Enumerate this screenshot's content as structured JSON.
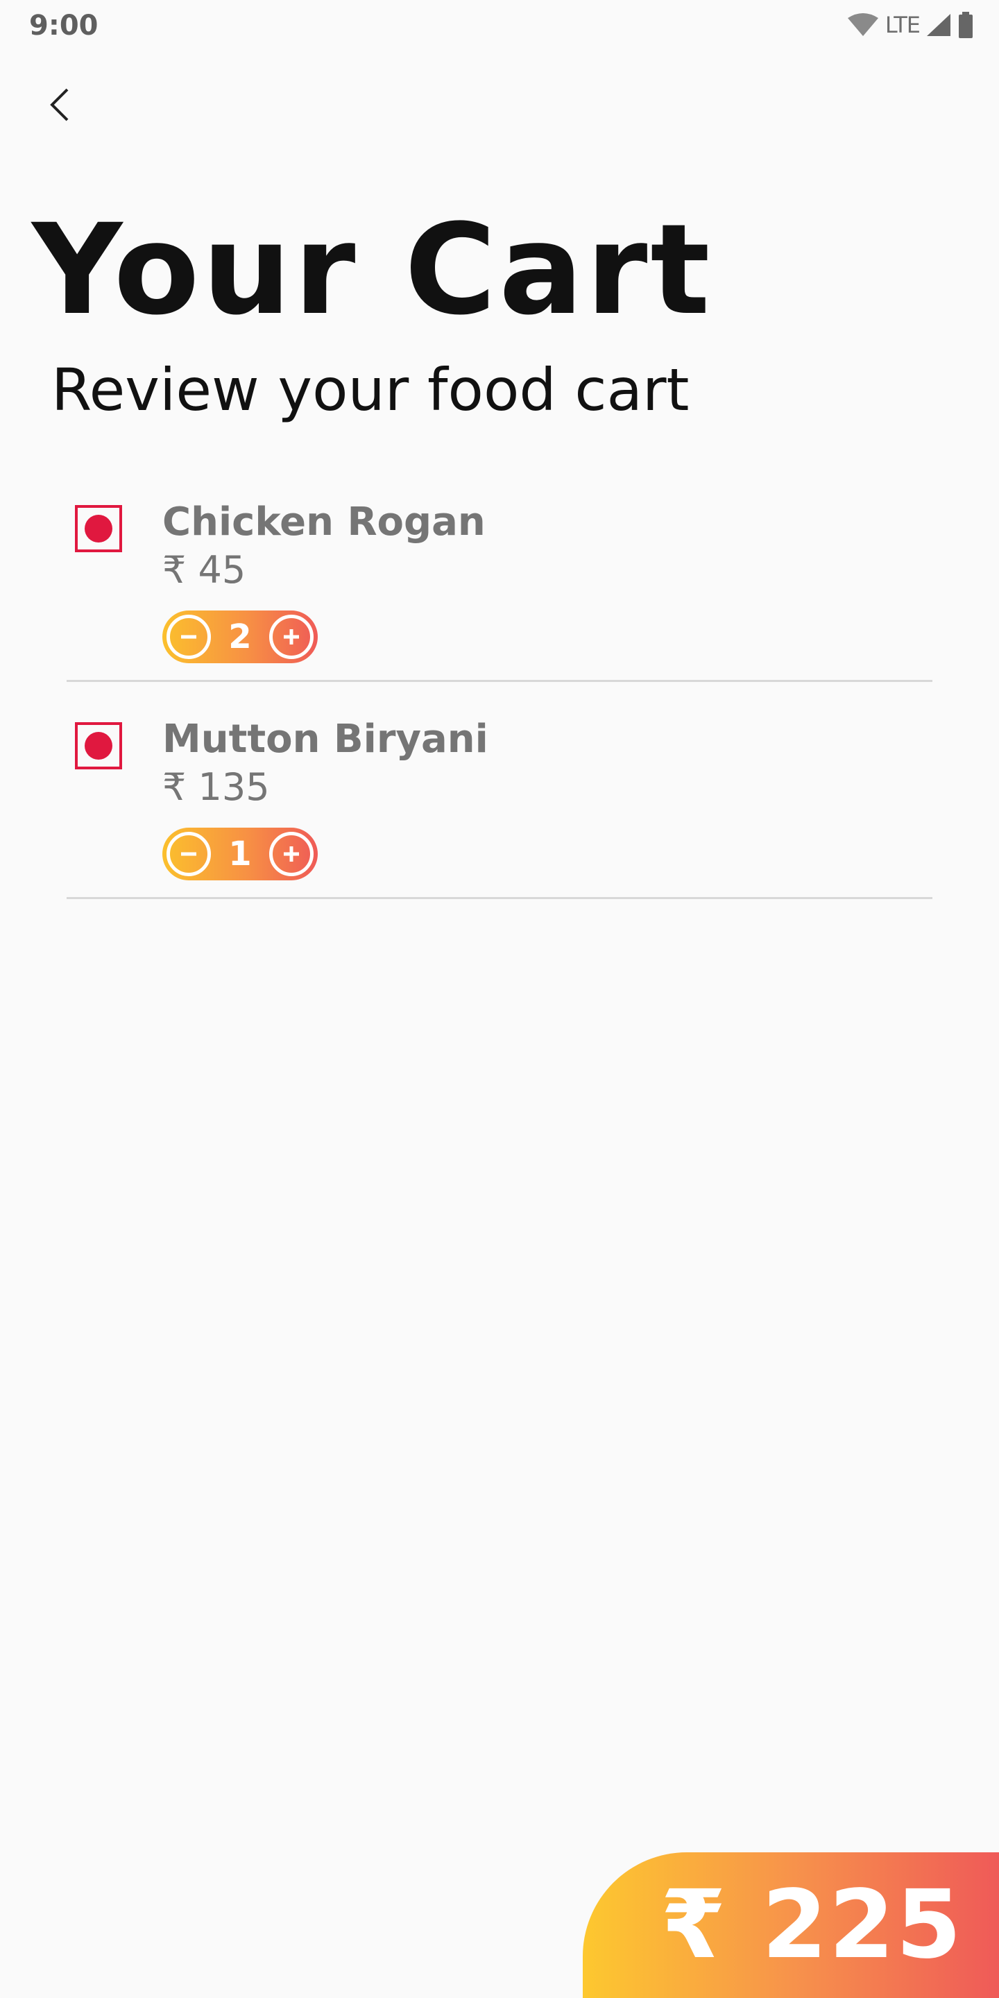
{
  "status_bar": {
    "time": "9:00",
    "network": "LTE",
    "icons": [
      "wifi-icon",
      "signal-icon",
      "battery-icon"
    ]
  },
  "header": {
    "back_icon": "back-chevron-icon",
    "title": "Your Cart",
    "subtitle": "Review your food cart"
  },
  "cart": {
    "items": [
      {
        "name": "Chicken Rogan",
        "price": "₹ 45",
        "quantity": "2"
      },
      {
        "name": "Mutton Biryani",
        "price": "₹ 135",
        "quantity": "1"
      }
    ]
  },
  "total": {
    "label": "₹ 225"
  },
  "colors": {
    "accent_start": "#fdc82f",
    "accent_end": "#ef5a58",
    "marker_red": "#e0183f"
  }
}
